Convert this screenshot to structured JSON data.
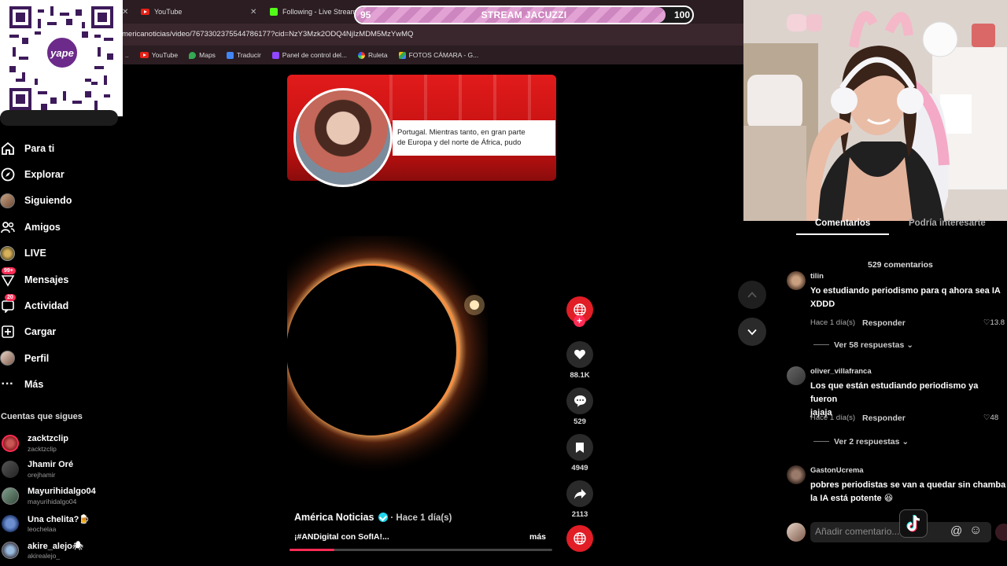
{
  "browser": {
    "tabs": [
      {
        "title": "YouTube"
      },
      {
        "title": "Following - Live Streams"
      }
    ],
    "url": "mericanoticias/video/7673302375544786177?cid=NzY3Mzk2ODQ4NjIzMDM5MzYwMQ",
    "bookmarks": [
      "YouTube",
      "Maps",
      "Traducir",
      "Panel de control del...",
      "Ruleta",
      "FOTOS CÁMARA - G..."
    ]
  },
  "goal": {
    "start": "95",
    "end": "100",
    "label": "STREAM JACUZZI",
    "progress": 0.92
  },
  "qr": {
    "brand": "yape",
    "badge": "S/"
  },
  "sidebar": {
    "nav": [
      {
        "label": "Para ti",
        "icon": "home-icon"
      },
      {
        "label": "Explorar",
        "icon": "compass-icon"
      },
      {
        "label": "Siguiendo",
        "icon": "avatar"
      },
      {
        "label": "Amigos",
        "icon": "friends-icon"
      },
      {
        "label": "LIVE",
        "icon": "live-icon"
      },
      {
        "label": "Mensajes",
        "icon": "messages-icon",
        "badge": "99+"
      },
      {
        "label": "Actividad",
        "icon": "activity-icon",
        "badge": "20"
      },
      {
        "label": "Cargar",
        "icon": "upload-icon"
      },
      {
        "label": "Perfil",
        "icon": "avatar"
      },
      {
        "label": "Más",
        "icon": "more-icon"
      }
    ],
    "following_title": "Cuentas que sigues",
    "accounts": [
      {
        "name": "zacktzclip",
        "handle": "zacktzclip"
      },
      {
        "name": "Jhamir Oré",
        "handle": "orejhamir"
      },
      {
        "name": "Mayurihidalgo04",
        "handle": "mayurihidalgo04"
      },
      {
        "name": "Una chelita?🍺",
        "handle": "leochelaa"
      },
      {
        "name": "akire_alejo🕷",
        "handle": "akirealejo_"
      }
    ]
  },
  "video": {
    "caption_line1": "Portugal. Mientras tanto, en gran parte",
    "caption_line2": "de Europa y del norte de África, pudo",
    "author": "América Noticias",
    "time": "· Hace 1 día(s)",
    "description": "¡#ANDigital con SofIA!...",
    "more": "más",
    "progress": 0.17
  },
  "actions": {
    "likes": "88.1K",
    "comments": "529",
    "saves": "4949",
    "shares": "2113"
  },
  "comments_panel": {
    "tabs": [
      "Comentarios",
      "Podría interesarte"
    ],
    "count": "529 comentarios",
    "items": [
      {
        "user": "tilin",
        "text": "Yo estudiando periodismo para q ahora sea IA\nXDDD",
        "meta": "Hace 1 día(s)",
        "reply": "Responder",
        "likes": "13.8",
        "more": "Ver 58 respuestas ⌄"
      },
      {
        "user": "oliver_villafranca",
        "text": "Los que están estudiando periodismo ya fueron\njajaja",
        "meta": "Hace 1 día(s)",
        "reply": "Responder",
        "likes": "48",
        "more": "Ver 2 respuestas ⌄"
      },
      {
        "user": "GastonUcrema",
        "text": "pobres periodistas se van a quedar sin chamba\nla IA está potente 😆",
        "meta": "",
        "reply": "",
        "likes": "",
        "more": ""
      }
    ],
    "input_placeholder": "Añadir comentario..."
  }
}
